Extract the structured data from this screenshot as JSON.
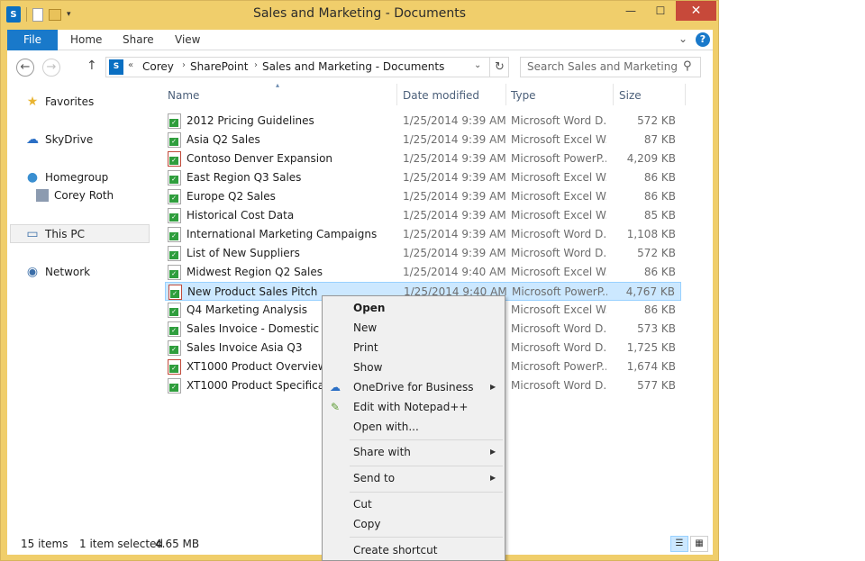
{
  "window": {
    "title": "Sales and Marketing - Documents",
    "close_glyph": "✕",
    "minimize_glyph": "—",
    "maximize_glyph": "☐"
  },
  "ribbon": {
    "tabs": [
      "File",
      "Home",
      "Share",
      "View"
    ]
  },
  "address": {
    "overflow": "«",
    "crumbs": [
      "Corey",
      "SharePoint",
      "Sales and Marketing - Documents"
    ],
    "search_placeholder": "Search Sales and Marketing - ..."
  },
  "nav": {
    "favorites": "Favorites",
    "skydrive": "SkyDrive",
    "homegroup": "Homegroup",
    "user": "Corey Roth",
    "thispc": "This PC",
    "network": "Network"
  },
  "columns": {
    "name": "Name",
    "date": "Date modified",
    "type": "Type",
    "size": "Size"
  },
  "files": [
    {
      "name": "2012 Pricing Guidelines",
      "date": "1/25/2014 9:39 AM",
      "type": "Microsoft Word D...",
      "size": "572 KB"
    },
    {
      "name": "Asia Q2 Sales",
      "date": "1/25/2014 9:39 AM",
      "type": "Microsoft Excel W...",
      "size": "87 KB"
    },
    {
      "name": "Contoso Denver Expansion",
      "date": "1/25/2014 9:39 AM",
      "type": "Microsoft PowerP...",
      "size": "4,209 KB"
    },
    {
      "name": "East Region Q3 Sales",
      "date": "1/25/2014 9:39 AM",
      "type": "Microsoft Excel W...",
      "size": "86 KB"
    },
    {
      "name": "Europe Q2 Sales",
      "date": "1/25/2014 9:39 AM",
      "type": "Microsoft Excel W...",
      "size": "86 KB"
    },
    {
      "name": "Historical Cost Data",
      "date": "1/25/2014 9:39 AM",
      "type": "Microsoft Excel W...",
      "size": "85 KB"
    },
    {
      "name": "International Marketing Campaigns",
      "date": "1/25/2014 9:39 AM",
      "type": "Microsoft Word D...",
      "size": "1,108 KB"
    },
    {
      "name": "List of New Suppliers",
      "date": "1/25/2014 9:39 AM",
      "type": "Microsoft Word D...",
      "size": "572 KB"
    },
    {
      "name": "Midwest Region Q2 Sales",
      "date": "1/25/2014 9:40 AM",
      "type": "Microsoft Excel W...",
      "size": "86 KB"
    },
    {
      "name": "New Product Sales Pitch",
      "date": "1/25/2014 9:40 AM",
      "type": "Microsoft PowerP...",
      "size": "4,767 KB"
    },
    {
      "name": "Q4 Marketing Analysis",
      "date": "",
      "type": "Microsoft Excel W...",
      "size": "86 KB"
    },
    {
      "name": "Sales Invoice - Domestic",
      "date": "",
      "type": "Microsoft Word D...",
      "size": "573 KB"
    },
    {
      "name": "Sales Invoice Asia Q3",
      "date": "",
      "type": "Microsoft Word D...",
      "size": "1,725 KB"
    },
    {
      "name": "XT1000 Product Overview",
      "date": "",
      "type": "Microsoft PowerP...",
      "size": "1,674 KB"
    },
    {
      "name": "XT1000 Product Specifications",
      "date": "",
      "type": "Microsoft Word D...",
      "size": "577 KB"
    }
  ],
  "status": {
    "count": "15 items",
    "selected": "1 item selected",
    "size": "4.65 MB"
  },
  "context_menu": {
    "open": "Open",
    "new": "New",
    "print": "Print",
    "show": "Show",
    "onedrive": "OneDrive for Business",
    "notepad": "Edit with Notepad++",
    "open_with": "Open with...",
    "share_with": "Share with",
    "send_to": "Send to",
    "cut": "Cut",
    "copy": "Copy",
    "create_shortcut": "Create shortcut"
  },
  "colors": {
    "frame": "#f0ce6b",
    "file_tab": "#1979ca",
    "close_button": "#c7493a",
    "selection": "#cce8ff"
  }
}
